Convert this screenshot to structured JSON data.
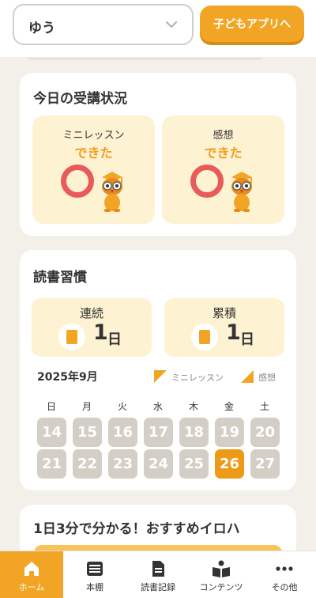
{
  "header": {
    "child_select_value": "ゆう",
    "kids_app_button": "子どもアプリへ"
  },
  "today_status": {
    "title": "今日の受講状況",
    "tiles": [
      {
        "label": "ミニレッスン",
        "status": "できた"
      },
      {
        "label": "感想",
        "status": "できた"
      }
    ]
  },
  "reading_habit": {
    "title": "読書習慣",
    "streak": {
      "label": "連続",
      "value": "1",
      "unit": "日"
    },
    "total": {
      "label": "累積",
      "value": "1",
      "unit": "日"
    },
    "calendar": {
      "month": "2025年9月",
      "legend": [
        "ミニレッスン",
        "感想"
      ],
      "weekdays": [
        "日",
        "月",
        "火",
        "水",
        "木",
        "金",
        "土"
      ],
      "week1": [
        "14",
        "15",
        "16",
        "17",
        "18",
        "19",
        "20"
      ],
      "week2": [
        "21",
        "22",
        "23",
        "24",
        "25",
        "26",
        "27"
      ],
      "today": "26"
    }
  },
  "recommend": {
    "title": "1日3分で分かる！おすすめイロハ"
  },
  "tabs": [
    "ホーム",
    "本棚",
    "読書記録",
    "コンテンツ",
    "その他"
  ],
  "colors": {
    "accent": "#f2a524",
    "tile_bg": "#fdf2d2",
    "ring": "#e95a5a",
    "day_gray": "#d3cec6"
  }
}
